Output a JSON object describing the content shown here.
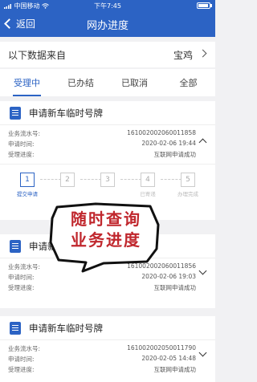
{
  "status_bar": {
    "carrier": "中国移动",
    "time": "下午7:45"
  },
  "nav": {
    "back_label": "返回",
    "title": "网办进度"
  },
  "source": {
    "label": "以下数据来自",
    "city": "宝鸡"
  },
  "tabs": [
    "受理中",
    "已办结",
    "已取消",
    "全部"
  ],
  "cards": [
    {
      "title": "申请新车临时号牌",
      "rows": [
        {
          "k": "业务流水号:",
          "v": "161002002060011858"
        },
        {
          "k": "申请时间:",
          "v": "2020-02-06 19:44"
        },
        {
          "k": "受理进度:",
          "v": "互联网申请成功"
        }
      ],
      "steps": [
        {
          "n": "1",
          "label": "提交申请"
        },
        {
          "n": "2",
          "label": ""
        },
        {
          "n": "3",
          "label": ""
        },
        {
          "n": "4",
          "label": "已寄递"
        },
        {
          "n": "5",
          "label": "办理完成"
        }
      ]
    },
    {
      "title": "申请新",
      "rows": [
        {
          "k": "业务流水号:",
          "v": "161002002060011856"
        },
        {
          "k": "申请时间:",
          "v": "2020-02-06 19:03"
        },
        {
          "k": "受理进度:",
          "v": "互联网申请成功"
        }
      ]
    },
    {
      "title": "申请新车临时号牌",
      "rows": [
        {
          "k": "业务流水号:",
          "v": "161002002050011790"
        },
        {
          "k": "申请时间:",
          "v": "2020-02-05 14:48"
        },
        {
          "k": "受理进度:",
          "v": "互联网申请成功"
        }
      ]
    }
  ],
  "overlay": {
    "line1": "随时查询",
    "line2": "业务进度"
  },
  "colors": {
    "primary": "#2c63c4",
    "overlay_text": "#c0272d"
  }
}
